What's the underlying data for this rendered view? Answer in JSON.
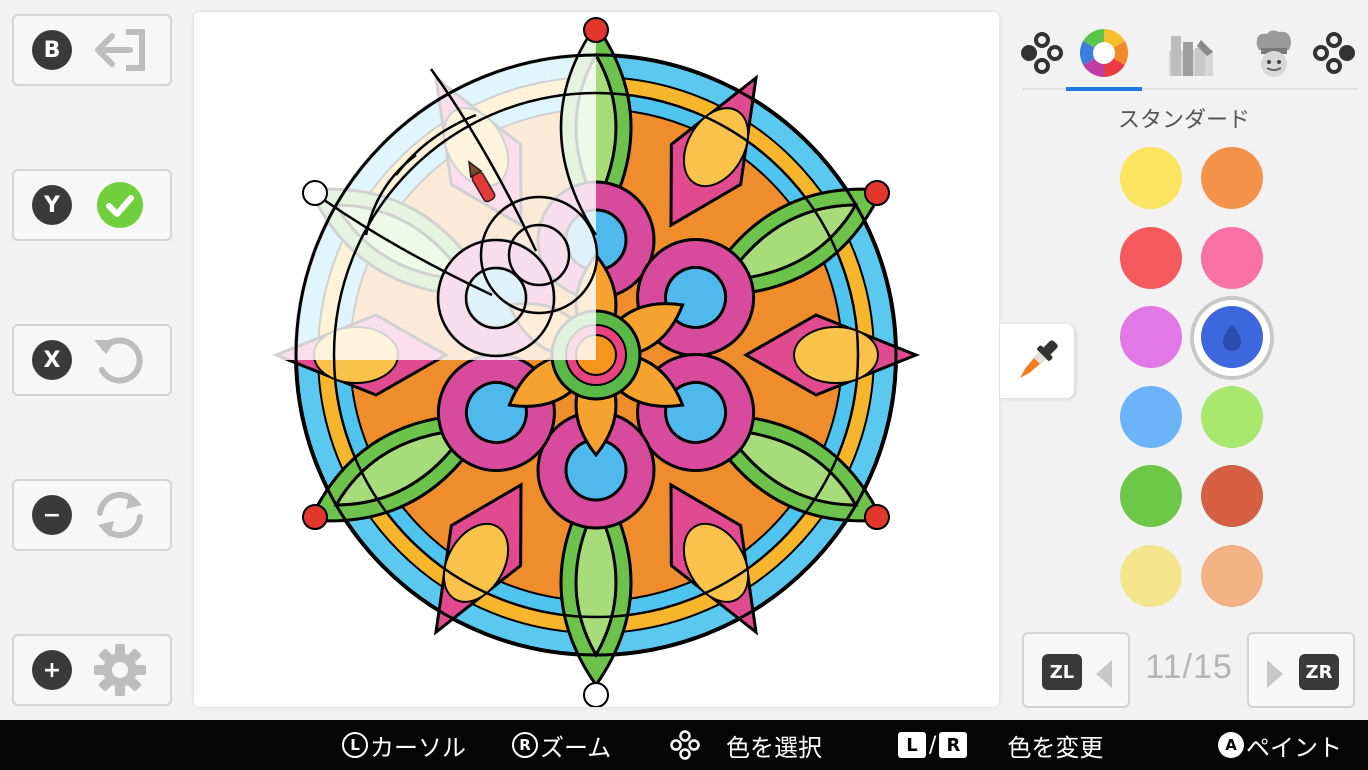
{
  "left_controls": [
    {
      "button": "B",
      "action_icon": "back-arrow-icon"
    },
    {
      "button": "Y",
      "action_icon": "confirm-check-icon"
    },
    {
      "button": "X",
      "action_icon": "undo-icon"
    },
    {
      "button": "−",
      "action_icon": "reset-cycle-icon"
    },
    {
      "button": "+",
      "action_icon": "settings-gear-icon"
    }
  ],
  "tabs": {
    "items": [
      "dpad-left-icon",
      "color-wheel-icon",
      "texture-icon",
      "chef-icon",
      "dpad-right-icon"
    ],
    "selected_index": 1
  },
  "palette": {
    "title": "スタンダード",
    "colors": [
      "#fbe460",
      "#f5924a",
      "#f45a5d",
      "#f772a3",
      "#e277e6",
      "#3d67dc",
      "#6cb4fa",
      "#a8e86c",
      "#6cc846",
      "#d45f42",
      "#f4e48c",
      "#f3b283"
    ],
    "selected_index": 5
  },
  "pager": {
    "prev_button": "ZL",
    "next_button": "ZR",
    "current": "11",
    "total": "15",
    "label": "11/15"
  },
  "bottom_hints": [
    {
      "glyph": "L",
      "label": "カーソル"
    },
    {
      "glyph": "R",
      "label": "ズーム"
    },
    {
      "glyph": "dpad",
      "label": "色を選択"
    },
    {
      "glyph": "L/R",
      "label": "色を変更"
    },
    {
      "glyph": "A",
      "label": "ペイント"
    }
  ],
  "colors": {
    "accent": "#1a7adc",
    "bar": "#050505"
  }
}
